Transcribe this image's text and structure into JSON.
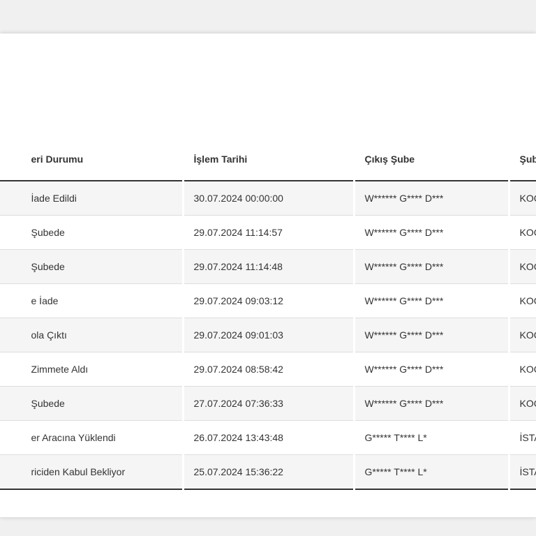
{
  "table": {
    "headers": [
      "eri Durumu",
      "İşlem Tarihi",
      "Çıkış Şube",
      "Şub"
    ],
    "rows": [
      {
        "status": "İade Edildi",
        "date": "30.07.2024 00:00:00",
        "branch_out": "W****** G**** D***",
        "branch": "KOC"
      },
      {
        "status": "Şubede",
        "date": "29.07.2024 11:14:57",
        "branch_out": "W****** G**** D***",
        "branch": "KOC"
      },
      {
        "status": "Şubede",
        "date": "29.07.2024 11:14:48",
        "branch_out": "W****** G**** D***",
        "branch": "KOC"
      },
      {
        "status": "e İade",
        "date": "29.07.2024 09:03:12",
        "branch_out": "W****** G**** D***",
        "branch": "KOC"
      },
      {
        "status": "ola Çıktı",
        "date": "29.07.2024 09:01:03",
        "branch_out": "W****** G**** D***",
        "branch": "KOC"
      },
      {
        "status": "Zimmete Aldı",
        "date": "29.07.2024 08:58:42",
        "branch_out": "W****** G**** D***",
        "branch": "KOC"
      },
      {
        "status": "Şubede",
        "date": "27.07.2024 07:36:33",
        "branch_out": "W****** G**** D***",
        "branch": "KOC"
      },
      {
        "status": "er Aracına Yüklendi",
        "date": "26.07.2024 13:43:48",
        "branch_out": "G***** T**** L*",
        "branch": "İSTA"
      },
      {
        "status": "riciden Kabul Bekliyor",
        "date": "25.07.2024 15:36:22",
        "branch_out": "G***** T**** L*",
        "branch": "İSTA"
      }
    ]
  }
}
